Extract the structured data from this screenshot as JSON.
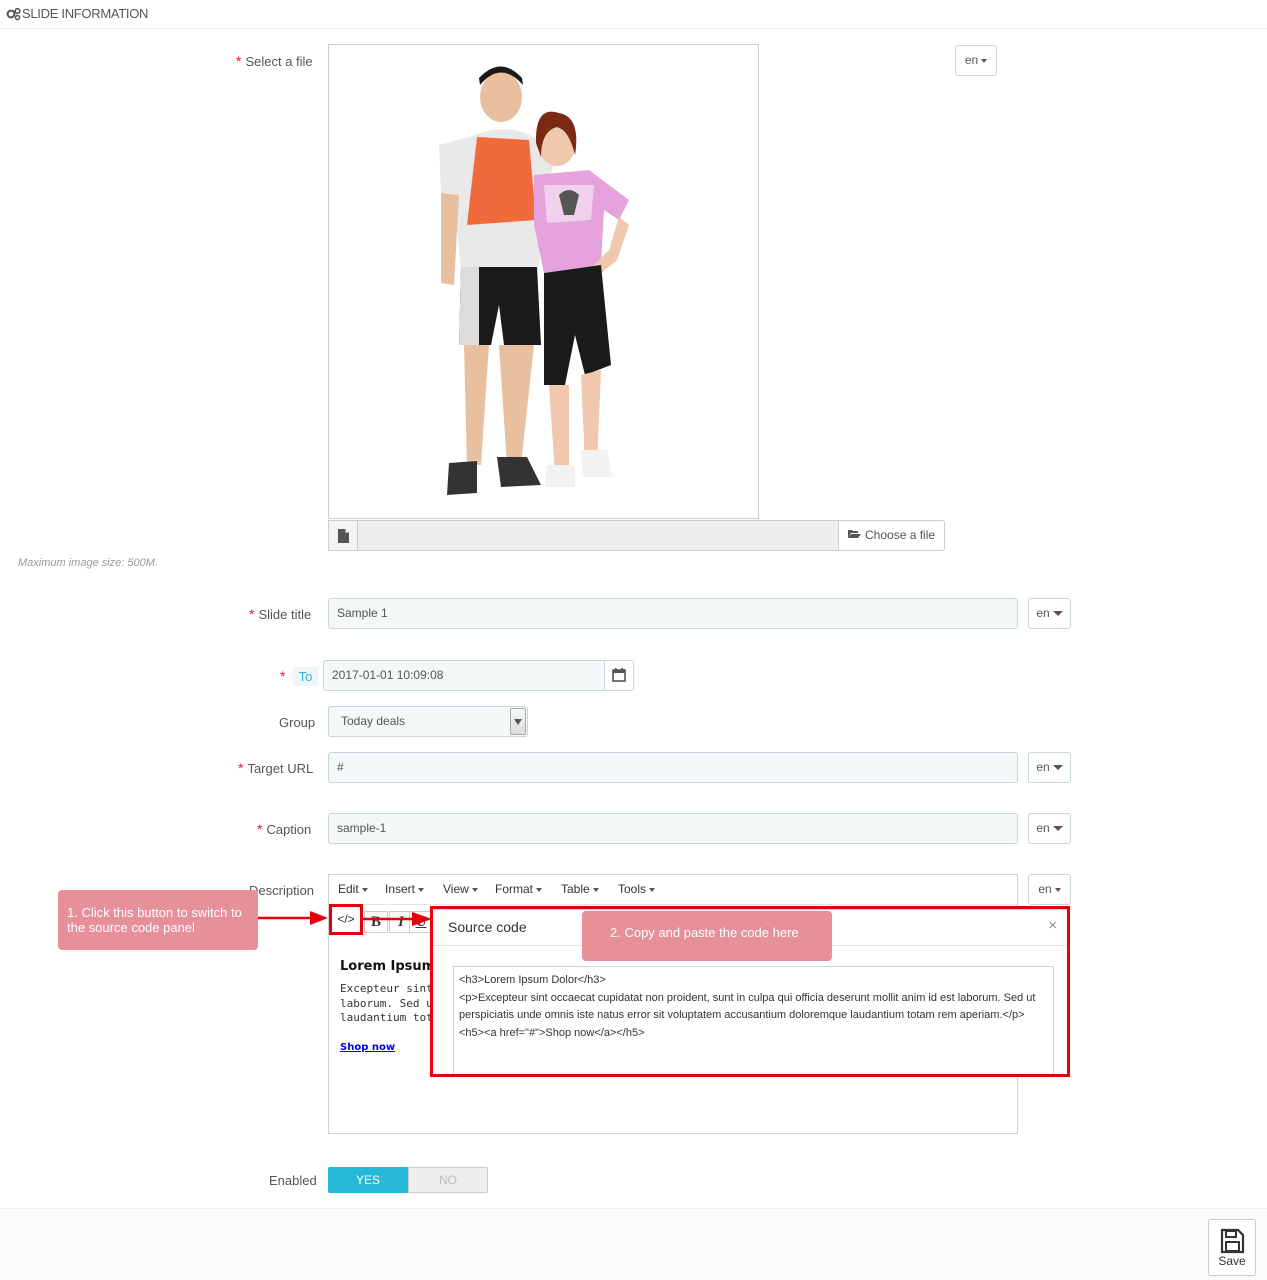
{
  "panel": {
    "title": "SLIDE INFORMATION",
    "icon": "gears-icon"
  },
  "fields": {
    "file": {
      "label": "Select a file",
      "lang": "en",
      "choose_label": "Choose a file",
      "help": "Maximum image size: 500M."
    },
    "slide_title": {
      "label": "Slide title",
      "value": "Sample 1",
      "lang": "en"
    },
    "to": {
      "addon": "To",
      "value": "2017-01-01 10:09:08"
    },
    "group": {
      "label": "Group",
      "value": "Today deals"
    },
    "target_url": {
      "label": "Target URL",
      "value": "#",
      "lang": "en"
    },
    "caption": {
      "label": "Caption",
      "value": "sample-1",
      "lang": "en"
    },
    "description": {
      "label": "Description",
      "lang": "en",
      "menus": [
        "Edit",
        "Insert",
        "View",
        "Format",
        "Table",
        "Tools"
      ],
      "source_button": "</>",
      "toolbar": [
        "B",
        "I",
        "U"
      ],
      "content": {
        "heading": "Lorem Ipsum",
        "paragraph": [
          "Excepteur sint",
          "laborum. Sed u",
          "laudantium tot"
        ],
        "link": "Shop now"
      }
    },
    "enabled": {
      "label": "Enabled",
      "yes": "YES",
      "no": "NO",
      "value": "YES"
    }
  },
  "source_dialog": {
    "title": "Source code",
    "close": "×",
    "code": "<h3>Lorem Ipsum Dolor</h3>\n<p>Excepteur sint occaecat cupidatat non proident, sunt in culpa qui officia deserunt mollit anim id est laborum. Sed ut perspiciatis unde omnis iste natus error sit voluptatem accusantium doloremque laudantium totam rem aperiam.</p>\n<h5><a href=\"#\">Shop now</a></h5>"
  },
  "callouts": {
    "step1": "1. Click this button to switch to the source code panel",
    "step2": "2. Copy and paste the code here"
  },
  "footer": {
    "save_label": "Save"
  },
  "colors": {
    "accent": "#25b9d7",
    "required": "#e3182d",
    "annotation_red": "#e5000c",
    "callout": "#e69099"
  }
}
